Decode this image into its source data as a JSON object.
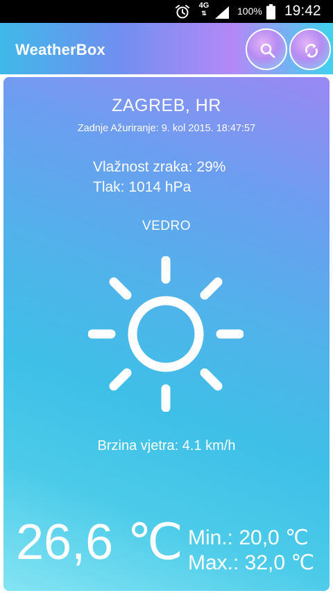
{
  "status_bar": {
    "network": "4G",
    "network_arrows": "⇅",
    "battery_percent": "100%",
    "time": "19:42",
    "icons": [
      "alarm-icon",
      "signal-icon",
      "battery-icon"
    ]
  },
  "app_bar": {
    "title": "WeatherBox",
    "actions": [
      {
        "name": "search",
        "icon": "search-icon"
      },
      {
        "name": "refresh",
        "icon": "refresh-icon"
      }
    ],
    "colors": {
      "accent_pink": "#b58cf3",
      "accent_blue": "#3fb9e9"
    }
  },
  "weather": {
    "city": "ZAGREB, HR",
    "updated": "Zadnje Ažuriranje: 9. kol 2015. 18:47:57",
    "humidity": "Vlažnost zraka: 29%",
    "pressure": "Tlak: 1014 hPa",
    "condition": "VEDRO",
    "condition_icon": "sun-icon",
    "wind": "Brzina vjetra: 4.1 km/h",
    "temp_current": "26,6 ℃",
    "temp_min": "Min.: 20,0 ℃",
    "temp_max": "Max.: 32,0 ℃"
  }
}
